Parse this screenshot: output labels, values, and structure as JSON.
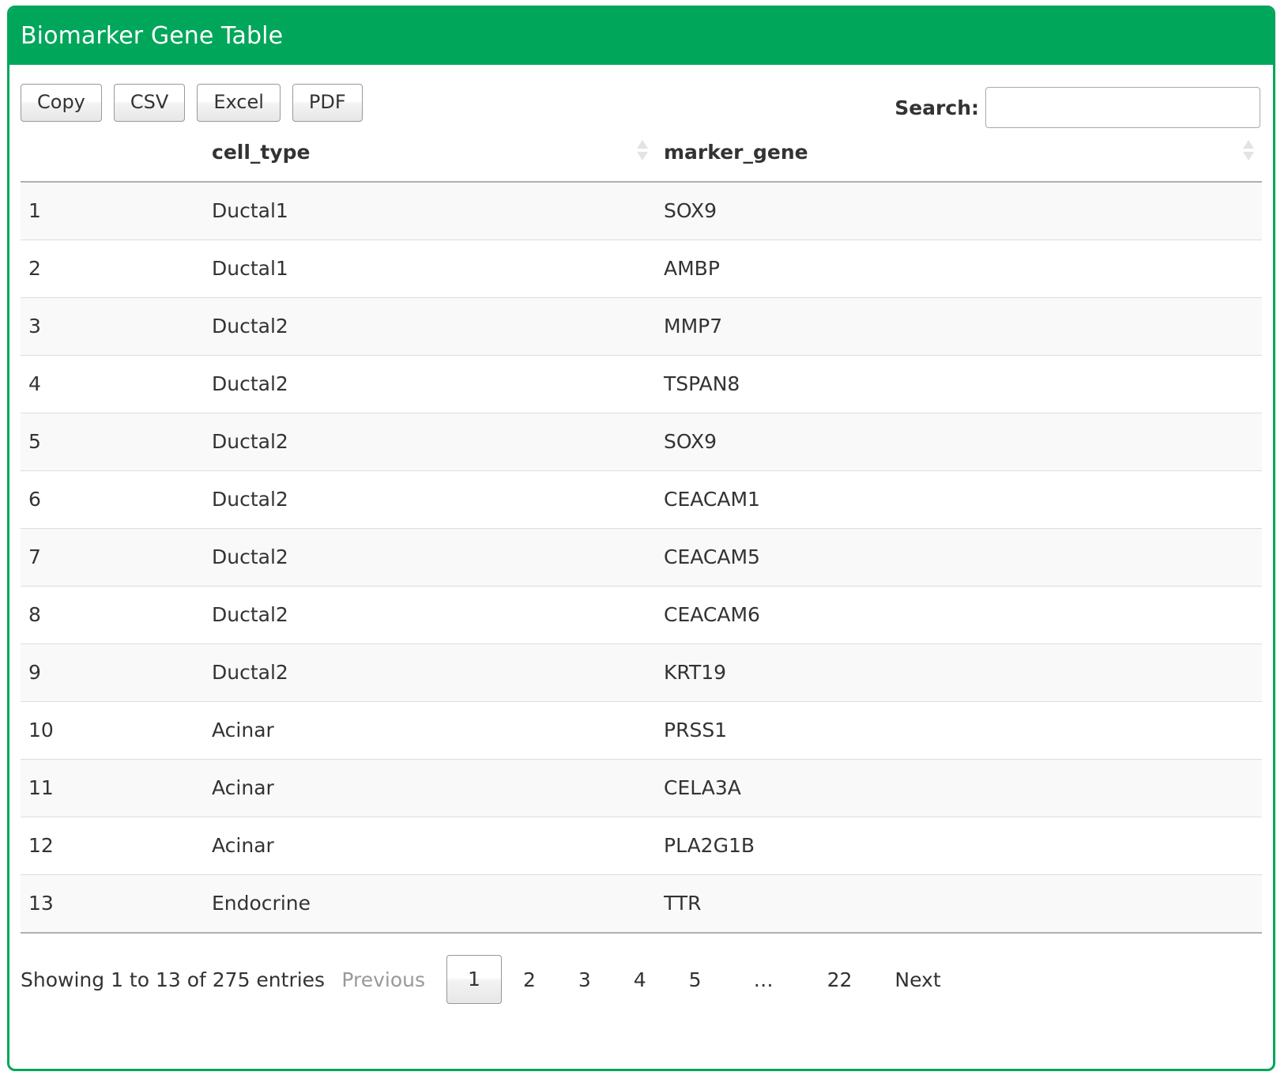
{
  "header": {
    "title": "Biomarker Gene Table",
    "accent_color": "#00a65a"
  },
  "toolbar": {
    "buttons": [
      {
        "label": "Copy",
        "name": "copy-button"
      },
      {
        "label": "CSV",
        "name": "csv-button"
      },
      {
        "label": "Excel",
        "name": "excel-button"
      },
      {
        "label": "PDF",
        "name": "pdf-button"
      }
    ]
  },
  "search": {
    "label": "Search:",
    "value": "",
    "placeholder": ""
  },
  "table": {
    "columns": [
      {
        "key": "index",
        "label": "",
        "sortable": false
      },
      {
        "key": "cell_type",
        "label": "cell_type",
        "sortable": true,
        "sort_icon": "sort-both-icon"
      },
      {
        "key": "marker_gene",
        "label": "marker_gene",
        "sortable": true,
        "sort_icon": "sort-both-icon"
      }
    ],
    "rows": [
      {
        "index": "1",
        "cell_type": "Ductal1",
        "marker_gene": "SOX9"
      },
      {
        "index": "2",
        "cell_type": "Ductal1",
        "marker_gene": "AMBP"
      },
      {
        "index": "3",
        "cell_type": "Ductal2",
        "marker_gene": "MMP7"
      },
      {
        "index": "4",
        "cell_type": "Ductal2",
        "marker_gene": "TSPAN8"
      },
      {
        "index": "5",
        "cell_type": "Ductal2",
        "marker_gene": "SOX9"
      },
      {
        "index": "6",
        "cell_type": "Ductal2",
        "marker_gene": "CEACAM1"
      },
      {
        "index": "7",
        "cell_type": "Ductal2",
        "marker_gene": "CEACAM5"
      },
      {
        "index": "8",
        "cell_type": "Ductal2",
        "marker_gene": "CEACAM6"
      },
      {
        "index": "9",
        "cell_type": "Ductal2",
        "marker_gene": "KRT19"
      },
      {
        "index": "10",
        "cell_type": "Acinar",
        "marker_gene": "PRSS1"
      },
      {
        "index": "11",
        "cell_type": "Acinar",
        "marker_gene": "CELA3A"
      },
      {
        "index": "12",
        "cell_type": "Acinar",
        "marker_gene": "PLA2G1B"
      },
      {
        "index": "13",
        "cell_type": "Endocrine",
        "marker_gene": "TTR"
      }
    ]
  },
  "footer": {
    "info": "Showing 1 to 13 of 275 entries",
    "pagination": [
      {
        "label": "Previous",
        "name": "page-previous",
        "state": "disabled"
      },
      {
        "label": "1",
        "name": "page-1",
        "state": "current"
      },
      {
        "label": "2",
        "name": "page-2",
        "state": "normal"
      },
      {
        "label": "3",
        "name": "page-3",
        "state": "normal"
      },
      {
        "label": "4",
        "name": "page-4",
        "state": "normal"
      },
      {
        "label": "5",
        "name": "page-5",
        "state": "normal"
      },
      {
        "label": "…",
        "name": "page-ellipsis",
        "state": "ellipsis"
      },
      {
        "label": "22",
        "name": "page-22",
        "state": "normal"
      },
      {
        "label": "Next",
        "name": "page-next",
        "state": "normal"
      }
    ]
  }
}
